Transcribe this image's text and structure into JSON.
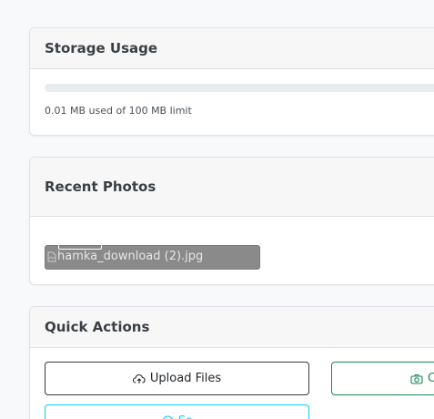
{
  "storage": {
    "title": "Storage Usage",
    "used_text": "0.01 MB used of 100 MB limit",
    "used_fraction": 0.0001
  },
  "photos": {
    "title": "Recent Photos",
    "items": [
      {
        "alt": "hamka_download (2).jpg"
      }
    ]
  },
  "actions": {
    "title": "Quick Actions",
    "upload_label": "Upload Files",
    "camera_label": "C",
    "third_label": "Sc"
  },
  "colors": {
    "upload_border": "#343a40",
    "camera_accent": "#198754",
    "third_accent": "#0dcaf0"
  },
  "icons": {
    "upload": "cloud-upload-icon",
    "camera": "camera-icon",
    "third": "circle-icon",
    "broken_image": "broken-image-icon"
  }
}
